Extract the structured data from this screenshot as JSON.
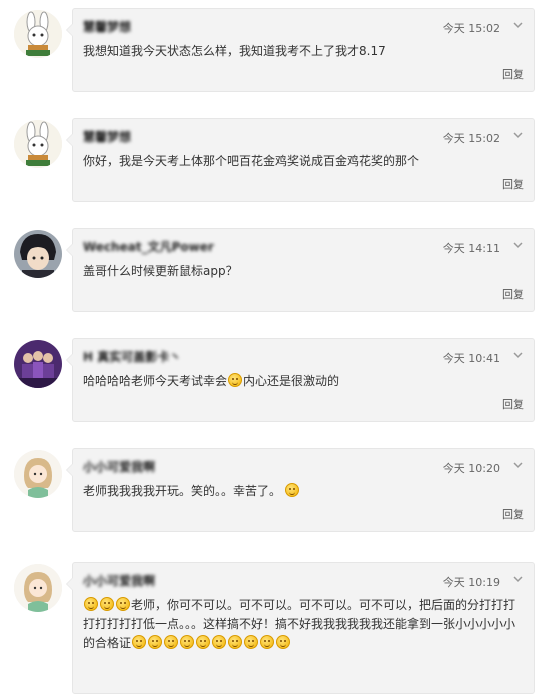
{
  "comments": [
    {
      "username": "慧馨梦想",
      "time": "今天 15:02",
      "text": "我想知道我今天状态怎么样，我知道我考不上了我才8.17",
      "reply": "回复",
      "avatar": "rabbit-avatar"
    },
    {
      "username": "慧馨梦想",
      "time": "今天 15:02",
      "text": "你好，我是今天考上体那个吧百花金鸡奖说成百金鸡花奖的那个",
      "reply": "回复",
      "avatar": "rabbit-avatar"
    },
    {
      "username": "Wecheat_文凡Power",
      "time": "今天 14:11",
      "text": "盖哥什么时候更新鼠标app？",
      "reply": "回复",
      "avatar": "anime-boy-avatar"
    },
    {
      "username": "H 真实可盖影卡丶",
      "time": "今天 10:41",
      "text_before": "哈哈哈哈老师今天考试幸会",
      "text_after": "内心还是很激动的",
      "reply": "回复",
      "avatar": "group-photo-avatar"
    },
    {
      "username": "小小可爱我啊",
      "time": "今天 10:20",
      "text": "老师我我我我开玩。笑的。。幸苦了。",
      "reply": "回复",
      "avatar": "cartoon-girl-avatar"
    },
    {
      "username": "小小可爱我啊",
      "time": "今天 10:19",
      "text_main": "老师，你可不可以。可不可以。可不可以。可不可以，把后面的分打打打打打打打打低一点。。。这样搞不好！搞不好我我我我我我还能拿到一张小小小小小的合格证",
      "reply": "回复",
      "avatar": "cartoon-girl-avatar"
    }
  ],
  "colors": {
    "bubble_bg": "#f3f3f3",
    "bubble_border": "#e6e6e6",
    "text": "#333333",
    "meta": "#666666"
  }
}
